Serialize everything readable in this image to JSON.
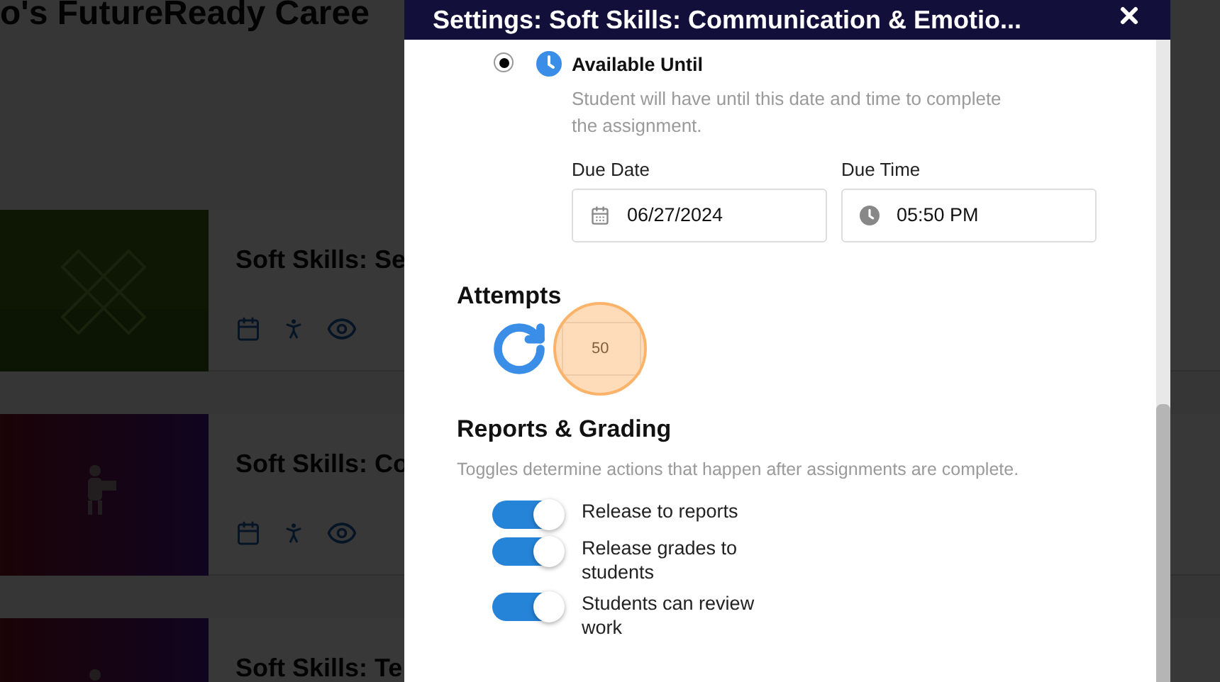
{
  "page": {
    "heading": "o's FutureReady Caree"
  },
  "lessons": [
    {
      "title": "Soft Skills: Se"
    },
    {
      "title": "Soft Skills: Co"
    },
    {
      "title": "Soft Skills: Te"
    }
  ],
  "dialog": {
    "title": "Settings: Soft Skills: Communication & Emotio...",
    "availability": {
      "selected": true,
      "label": "Available Until",
      "description": "Student will have until this date and time to complete the assignment."
    },
    "due_date": {
      "label": "Due Date",
      "value": "06/27/2024"
    },
    "due_time": {
      "label": "Due Time",
      "value": "05:50 PM"
    },
    "attempts": {
      "heading": "Attempts",
      "value": "50",
      "highlighted": true
    },
    "reports": {
      "heading": "Reports & Grading",
      "description": "Toggles determine actions that happen after assignments are complete.",
      "toggles": [
        {
          "label": "Release to reports",
          "on": true
        },
        {
          "label": "Release grades to students",
          "on": true
        },
        {
          "label": "Students can review work",
          "on": true
        }
      ]
    }
  }
}
